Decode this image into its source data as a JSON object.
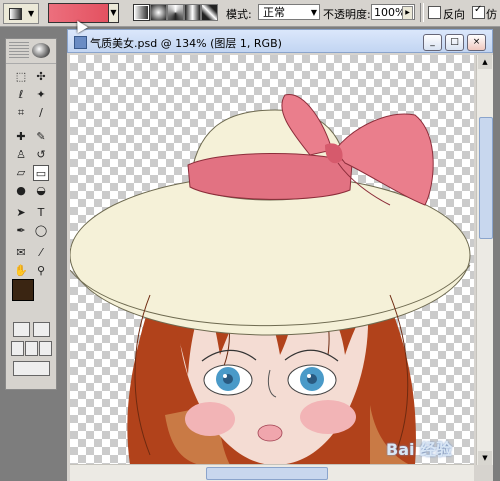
{
  "options_bar": {
    "tool_preset_icon": "gradient-tool-icon",
    "gradient_colors": [
      "#ec6f7d",
      "#e3505f"
    ],
    "gradient_types": [
      "linear-gradient-icon",
      "radial-gradient-icon",
      "angle-gradient-icon",
      "reflected-gradient-icon",
      "diamond-gradient-icon"
    ],
    "mode_label": "模式:",
    "mode_value": "正常",
    "opacity_label": "不透明度:",
    "opacity_value": "100%",
    "reverse_label": "反向",
    "dither_label": "仿"
  },
  "toolbox": {
    "tools": [
      "move-icon",
      "marquee-icon",
      "lasso-icon",
      "magic-wand-icon",
      "crop-icon",
      "slice-icon",
      "healing-brush-icon",
      "brush-icon",
      "clone-stamp-icon",
      "history-brush-icon",
      "eraser-icon",
      "gradient-icon",
      "blur-icon",
      "dodge-icon",
      "path-select-icon",
      "type-icon",
      "pen-icon",
      "shape-icon",
      "notes-icon",
      "eyedropper-icon",
      "hand-icon",
      "zoom-icon"
    ],
    "foreground_color": "#3a2512",
    "background_color": "#f6e6b6"
  },
  "document": {
    "title": "气质美女.psd @ 134% (图层 1, RGB)",
    "min_label": "_",
    "max_label": "□",
    "close_label": "×"
  },
  "watermark": "Bai 经验"
}
